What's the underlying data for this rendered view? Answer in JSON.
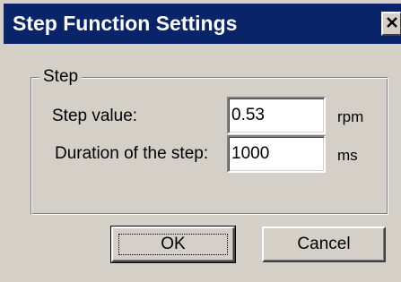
{
  "window": {
    "title": "Step Function Settings",
    "close_icon": "close-icon"
  },
  "group": {
    "label": "Step"
  },
  "fields": {
    "step_value": {
      "label": "Step value:",
      "value": "0.53",
      "unit": "rpm"
    },
    "duration": {
      "label": "Duration of the step:",
      "value": "1000",
      "unit": "ms"
    }
  },
  "buttons": {
    "ok_label": "OK",
    "cancel_label": "Cancel"
  },
  "colors": {
    "titlebar": "#0a246a",
    "face": "#d4d0c8"
  }
}
